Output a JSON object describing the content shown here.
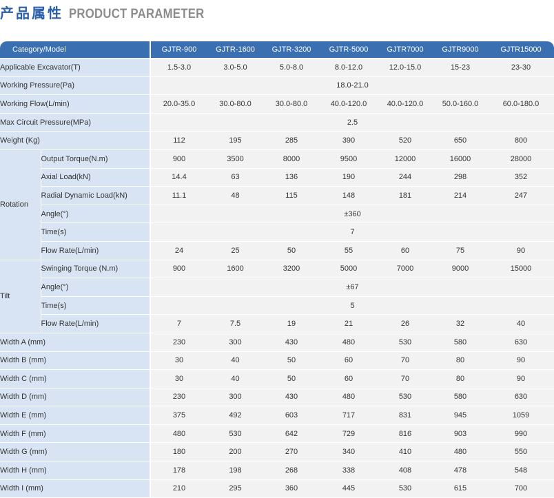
{
  "title": {
    "cn": "产品属性",
    "en": "PRODUCT PARAMETER"
  },
  "table": {
    "header": {
      "first": "Category/Model",
      "models": [
        "GJTR-900",
        "GJTR-1600",
        "GJTR-3200",
        "GJTR-5000",
        "GJTR7000",
        "GJTR9000",
        "GJTR15000"
      ]
    },
    "rows": [
      {
        "label": "Applicable Excavator(T)",
        "values": [
          "1.5-3.0",
          "3.0-5.0",
          "5.0-8.0",
          "8.0-12.0",
          "12.0-15.0",
          "15-23",
          "23-30"
        ]
      },
      {
        "label": "Working Pressure(Pa)",
        "span": "18.0-21.0"
      },
      {
        "label": "Working Flow(L/min)",
        "values": [
          "20.0-35.0",
          "30.0-80.0",
          "30.0-80.0",
          "40.0-120.0",
          "40.0-120.0",
          "50.0-160.0",
          "60.0-180.0"
        ]
      },
      {
        "label": "Max Circuit Pressure(MPa)",
        "span": "2.5"
      },
      {
        "label": "Weight (Kg)",
        "values": [
          "112",
          "195",
          "285",
          "390",
          "520",
          "650",
          "800"
        ]
      },
      {
        "group": "Rotation",
        "label": "Output Torque(N.m)",
        "values": [
          "900",
          "3500",
          "8000",
          "9500",
          "12000",
          "16000",
          "28000"
        ]
      },
      {
        "group": "Rotation",
        "label": "Axial  Load(kN)",
        "values": [
          "14.4",
          "63",
          "136",
          "190",
          "244",
          "298",
          "352"
        ]
      },
      {
        "group": "Rotation",
        "label": "Radial Dynamic Load(kN)",
        "values": [
          "11.1",
          "48",
          "115",
          "148",
          "181",
          "214",
          "247"
        ]
      },
      {
        "group": "Rotation",
        "label": "Angle(°)",
        "span": "±360"
      },
      {
        "group": "Rotation",
        "label": "Time(s)",
        "span": "7"
      },
      {
        "group": "Rotation",
        "label": "Flow Rate(L/min)",
        "values": [
          "24",
          "25",
          "50",
          "55",
          "60",
          "75",
          "90"
        ]
      },
      {
        "group": "Tilt",
        "label": "Swinging Torque (N.m)",
        "values": [
          "900",
          "1600",
          "3200",
          "5000",
          "7000",
          "9000",
          "15000"
        ]
      },
      {
        "group": "Tilt",
        "label": "Angle(°)",
        "span": "±67"
      },
      {
        "group": "Tilt",
        "label": "Time(s)",
        "span": "5"
      },
      {
        "group": "Tilt",
        "label": "Flow Rate(L/min)",
        "values": [
          "7",
          "7.5",
          "19",
          "21",
          "26",
          "32",
          "40"
        ]
      },
      {
        "label": "Width  A (mm)",
        "values": [
          "230",
          "300",
          "430",
          "480",
          "530",
          "580",
          "630"
        ]
      },
      {
        "label": "Width  B (mm)",
        "values": [
          "30",
          "40",
          "50",
          "60",
          "70",
          "80",
          "90"
        ]
      },
      {
        "label": "Width  C (mm)",
        "values": [
          "30",
          "40",
          "50",
          "60",
          "70",
          "80",
          "90"
        ]
      },
      {
        "label": "Width  D (mm)",
        "values": [
          "230",
          "300",
          "430",
          "480",
          "530",
          "580",
          "630"
        ]
      },
      {
        "label": "Width  E (mm)",
        "values": [
          "375",
          "492",
          "603",
          "717",
          "831",
          "945",
          "1059"
        ]
      },
      {
        "label": "Width  F (mm)",
        "values": [
          "480",
          "530",
          "642",
          "729",
          "816",
          "903",
          "990"
        ]
      },
      {
        "label": "Width  G (mm)",
        "values": [
          "180",
          "200",
          "270",
          "340",
          "410",
          "480",
          "550"
        ]
      },
      {
        "label": "Width  H (mm)",
        "values": [
          "178",
          "198",
          "268",
          "338",
          "408",
          "478",
          "548"
        ]
      },
      {
        "label": "Width  I (mm)",
        "values": [
          "210",
          "295",
          "360",
          "445",
          "530",
          "615",
          "700"
        ]
      }
    ]
  }
}
